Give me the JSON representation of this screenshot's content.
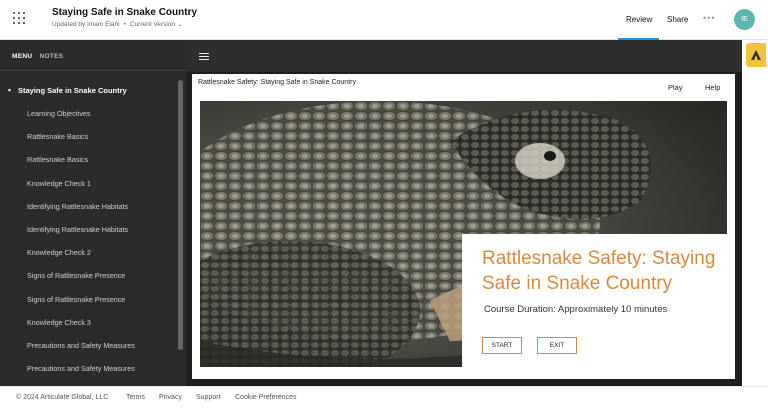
{
  "header": {
    "course_title": "Staying Safe in Snake Country",
    "updated_by": "Updated by Imam Elahi",
    "version": "Current Version",
    "tabs": [
      {
        "label": "Review"
      },
      {
        "label": "Share"
      }
    ],
    "more_label": "•••",
    "avatar_initials": "IE",
    "accent_color": "#2d8fd5"
  },
  "sidebar": {
    "tabs": [
      "MENU",
      "NOTES"
    ],
    "section_title": "Staying Safe in Snake Country",
    "items": [
      "Learning Objectives",
      "Rattlesnake Basics",
      "Rattlesnake Basics",
      "Knowledge Check 1",
      "Identifying Rattlesnake Habitats",
      "Identifying Rattlesnake Habitats",
      "Knowledge Check 2",
      "Signs of Rattlesnake Presence",
      "Signs of Rattlesnake Presence",
      "Knowledge Check 3",
      "Precautions and Safety Measures",
      "Precautions and Safety Measures"
    ]
  },
  "slide": {
    "title": "Rattlesnake Safety: Staying Safe in Snake Country",
    "play_label": "Play",
    "help_label": "Help",
    "heading": "Rattlesnake Safety: Staying Safe in Snake Country",
    "duration": "Course Duration: Approximately 10 minutes",
    "start_label": "START",
    "exit_label": "EXIT",
    "accent_color": "#d9893b"
  },
  "footer": {
    "copyright": "© 2024 Articulate Global, LLC",
    "links": [
      "Terms",
      "Privacy",
      "Support",
      "Cookie Preferences"
    ]
  }
}
